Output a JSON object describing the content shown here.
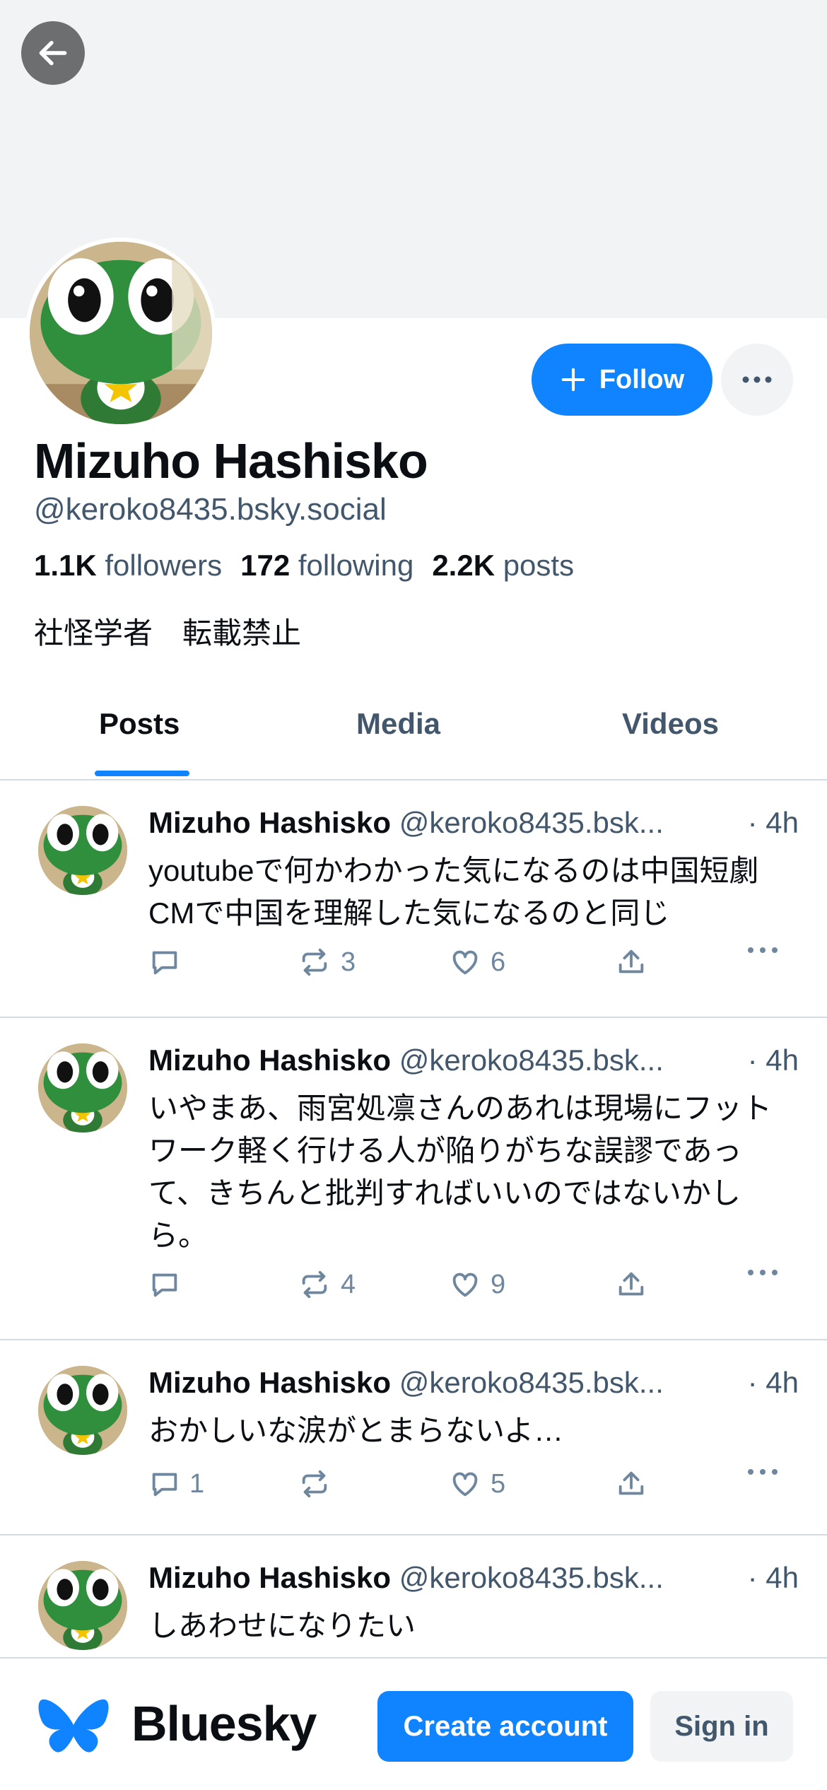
{
  "profile": {
    "display_name": "Mizuho Hashisko",
    "handle": "@keroko8435.bsky.social",
    "followers_count": "1.1K",
    "followers_label": "followers",
    "following_count": "172",
    "following_label": "following",
    "posts_count": "2.2K",
    "posts_label": "posts",
    "bio": "社怪学者　転載禁止",
    "follow_label": "Follow"
  },
  "tabs": [
    {
      "label": "Posts",
      "active": true
    },
    {
      "label": "Media",
      "active": false
    },
    {
      "label": "Videos",
      "active": false
    }
  ],
  "posts": [
    {
      "name": "Mizuho Hashisko",
      "handle": "@keroko8435.bsk...",
      "time": "· 4h",
      "text": "youtubeで何かわかった気になるのは中国短劇CMで中国を理解した気になるのと同じ",
      "replies": "",
      "reposts": "3",
      "likes": "6"
    },
    {
      "name": "Mizuho Hashisko",
      "handle": "@keroko8435.bsk...",
      "time": "· 4h",
      "text": "いやまあ、雨宮処凛さんのあれは現場にフットワーク軽く行ける人が陥りがちな誤謬であって、きちんと批判すればいいのではないかしら。",
      "replies": "",
      "reposts": "4",
      "likes": "9"
    },
    {
      "name": "Mizuho Hashisko",
      "handle": "@keroko8435.bsk...",
      "time": "· 4h",
      "text": "おかしいな涙がとまらないよ…",
      "replies": "1",
      "reposts": "",
      "likes": "5"
    },
    {
      "name": "Mizuho Hashisko",
      "handle": "@keroko8435.bsk...",
      "time": "· 4h",
      "text": "しあわせになりたい"
    }
  ],
  "bottom_bar": {
    "brand": "Bluesky",
    "create_label": "Create account",
    "signin_label": "Sign in"
  },
  "colors": {
    "accent": "#1083fe",
    "muted_text": "#42576c",
    "icon_gray": "#6f869f",
    "banner": "#f1f3f5"
  },
  "icons": [
    "arrow-left-icon",
    "plus-icon",
    "ellipsis-icon",
    "reply-icon",
    "repost-icon",
    "like-icon",
    "share-icon",
    "butterfly-logo-icon"
  ]
}
